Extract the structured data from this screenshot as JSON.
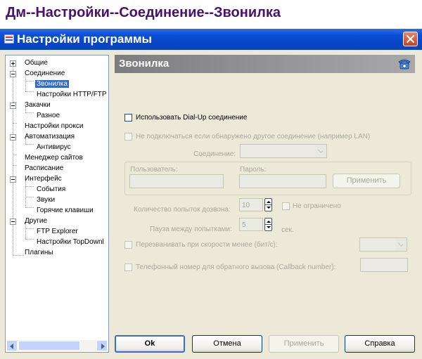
{
  "caption": "Дм--Настройки--Соединение--Звонилка",
  "window": {
    "title": "Настройки программы"
  },
  "tree": {
    "items": [
      "Общие",
      "Соединение",
      "Звонилка",
      "Настройки HTTP/FTP",
      "Закачки",
      "Разное",
      "Настройки прокси",
      "Автоматизация",
      "Антивирус",
      "Менеджер сайтов",
      "Расписание",
      "Интерфейс",
      "События",
      "Звуки",
      "Горячие клавиши",
      "Другие",
      "FTP Explorer",
      "Настройки TopDownl",
      "Плагины"
    ]
  },
  "panel": {
    "title": "Звонилка",
    "use_dialup": "Использовать Dial-Up соединение",
    "no_connect_if_other": "Не подключаться если обнаружено другое соединение (например LAN)",
    "connection_label": "Соединение:",
    "user_label": "Пользователь:",
    "password_label": "Пароль:",
    "apply_inner": "Применить",
    "attempts_label": "Количество попыток дозвона:",
    "attempts_value": "10",
    "unlimited": "Не ограничено",
    "pause_label": "Пауза между попытками:",
    "pause_value": "5",
    "pause_unit": "сек.",
    "redial_speed": "Перезванивать при скорости менее (бит/с):",
    "callback_phone": "Телефонный номер для обратного вызова (Callback number):"
  },
  "buttons": {
    "ok": "Ok",
    "cancel": "Отмена",
    "apply": "Применить",
    "help": "Справка"
  }
}
